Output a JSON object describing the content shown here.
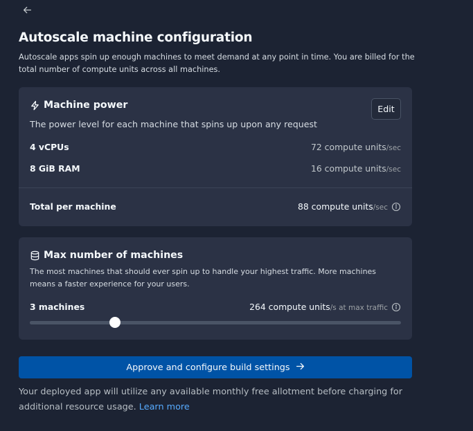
{
  "header": {
    "title": "Autoscale machine configuration",
    "description": "Autoscale apps spin up enough machines to meet demand at any point in time. You are billed for the total number of compute units across all machines."
  },
  "machine_power": {
    "title": "Machine power",
    "subtitle": "The power level for each machine that spins up upon any request",
    "edit_label": "Edit",
    "rows": [
      {
        "label": "4 vCPUs",
        "value": "72 compute units",
        "unit": "/sec"
      },
      {
        "label": "8 GiB RAM",
        "value": "16 compute units",
        "unit": "/sec"
      }
    ],
    "total": {
      "label": "Total per machine",
      "value": "88 compute units",
      "unit": "/sec"
    }
  },
  "max_machines": {
    "title": "Max number of machines",
    "subtitle": "The most machines that should ever spin up to handle your highest traffic. More machines means a faster experience for your users.",
    "count_label": "3 machines",
    "value": "264 compute units",
    "unit": "/s at max traffic",
    "slider_fraction": 0.23
  },
  "approve_button": {
    "label": "Approve and configure build settings"
  },
  "footer": {
    "text": "Your deployed app will utilize any available monthly free allotment before charging for additional resource usage. ",
    "link": "Learn more"
  },
  "colors": {
    "background": "#1c2333",
    "card": "#2b3245",
    "primary": "#0053a6",
    "link": "#57abff"
  },
  "icons": {
    "back": "arrow-left-icon",
    "power": "lightning-icon",
    "machines": "database-icon",
    "info": "info-icon",
    "approve": "arrow-right-icon"
  }
}
